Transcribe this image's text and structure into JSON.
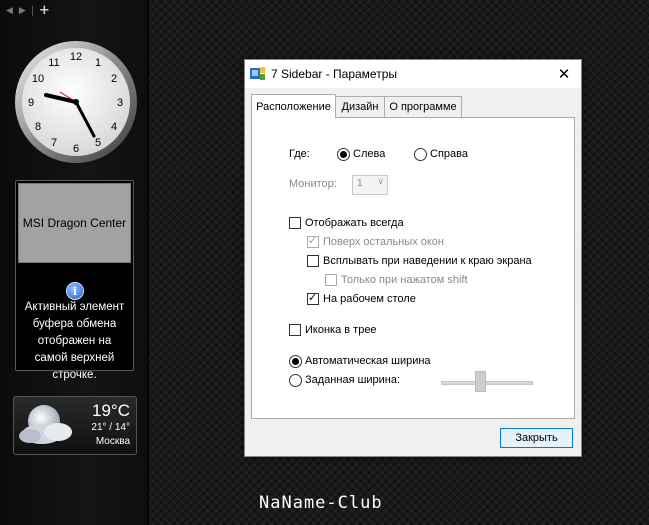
{
  "sidebar": {
    "toolbar": {
      "prev": "◀",
      "next": "▶",
      "add": "+"
    },
    "clipboard": {
      "item_text": "MSI Dragon Center",
      "info_glyph": "i",
      "message": "Активный элемент буфера обмена отображен на самой верхней строчке."
    },
    "weather": {
      "temperature": "19°C",
      "range": "21° / 14°",
      "city": "Москва"
    }
  },
  "dialog": {
    "title": "7 Sidebar - Параметры",
    "close_glyph": "✕",
    "tabs": [
      "Расположение",
      "Дизайн",
      "О программе"
    ],
    "active_tab": 0,
    "position": {
      "label": "Где:",
      "left": "Слева",
      "right": "Справа",
      "selected": "left"
    },
    "monitor": {
      "label": "Монитор:",
      "value": "1",
      "arrow": "∨"
    },
    "options": {
      "always_show": {
        "label": "Отображать всегда",
        "checked": false
      },
      "topmost": {
        "label": "Поверх остальных окон",
        "checked": true,
        "disabled": true
      },
      "popup_edge": {
        "label": "Всплывать при наведении к краю экрана",
        "checked": false
      },
      "shift_only": {
        "label": "Только при нажатом shift",
        "checked": false,
        "disabled": true
      },
      "on_desktop": {
        "label": "На рабочем столе",
        "checked": true
      },
      "tray_icon": {
        "label": "Иконка в трее",
        "checked": false
      }
    },
    "width": {
      "auto": "Автоматическая ширина",
      "fixed": "Заданная ширина:",
      "selected": "auto"
    },
    "close_button": "Закрыть"
  },
  "watermark": "NaName-Club",
  "colors": {
    "accent": "#0078d7",
    "button_bg": "#e5f1fb",
    "tab_panel": "#ffffff"
  }
}
